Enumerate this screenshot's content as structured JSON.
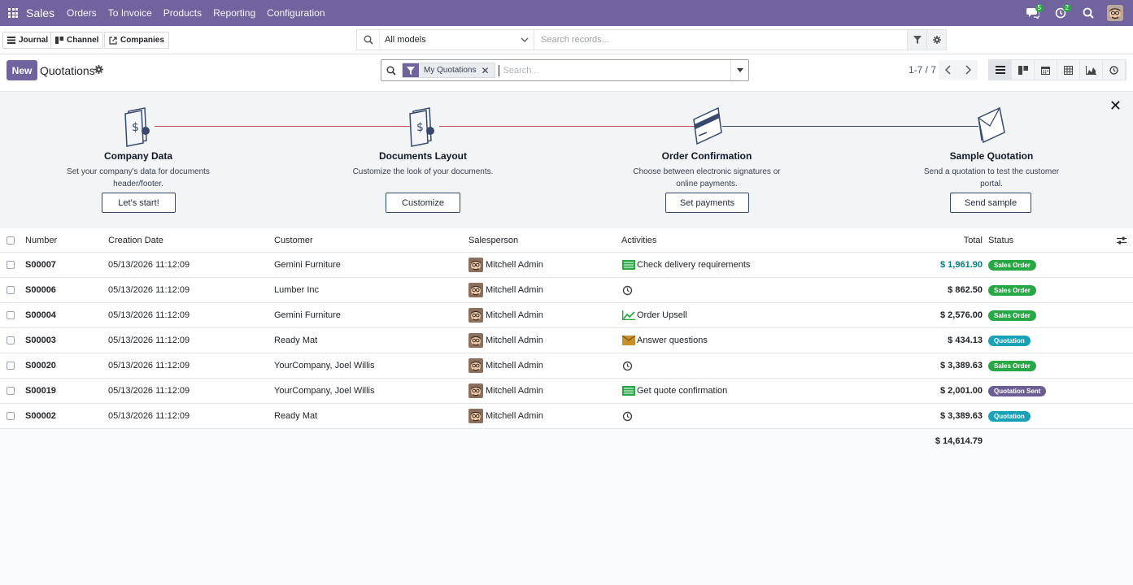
{
  "navbar": {
    "app_name": "Sales",
    "menu": [
      "Orders",
      "To Invoice",
      "Products",
      "Reporting",
      "Configuration"
    ],
    "messages_count": "5",
    "activities_count": "2"
  },
  "toolbar": {
    "journal": "Journal",
    "channel": "Channel",
    "companies": "Companies",
    "model_select": "All models",
    "search_placeholder": "Search records..."
  },
  "control": {
    "new_label": "New",
    "title": "Quotations",
    "facet": "My Quotations",
    "search_placeholder": "Search...",
    "pager": "1-7 / 7"
  },
  "onboarding": {
    "steps": [
      {
        "title": "Company Data",
        "desc1": "Set your company's data for documents",
        "desc2": "header/footer.",
        "button": "Let's start!"
      },
      {
        "title": "Documents Layout",
        "desc1": "Customize the look of your documents.",
        "desc2": "",
        "button": "Customize"
      },
      {
        "title": "Order Confirmation",
        "desc1": "Choose between electronic signatures or",
        "desc2": "online payments.",
        "button": "Set payments"
      },
      {
        "title": "Sample Quotation",
        "desc1": "Send a quotation to test the customer",
        "desc2": "portal.",
        "button": "Send sample"
      }
    ]
  },
  "table": {
    "headers": {
      "number": "Number",
      "date": "Creation Date",
      "customer": "Customer",
      "salesperson": "Salesperson",
      "activities": "Activities",
      "total": "Total",
      "status": "Status"
    },
    "rows": [
      {
        "number": "S00007",
        "date": "05/13/2026 11:12:09",
        "customer": "Gemini Furniture",
        "salesperson": "Mitchell Admin",
        "activity": "Check delivery requirements",
        "activity_icon": "todo-icon",
        "total": "$ 1,961.90",
        "status": "Sales Order"
      },
      {
        "number": "S00006",
        "date": "05/13/2026 11:12:09",
        "customer": "Lumber Inc",
        "salesperson": "Mitchell Admin",
        "activity": "",
        "activity_icon": "clock-icon",
        "total": "$ 862.50",
        "status": "Sales Order"
      },
      {
        "number": "S00004",
        "date": "05/13/2026 11:12:09",
        "customer": "Gemini Furniture",
        "salesperson": "Mitchell Admin",
        "activity": "Order Upsell",
        "activity_icon": "chart-icon",
        "total": "$ 2,576.00",
        "status": "Sales Order"
      },
      {
        "number": "S00003",
        "date": "05/13/2026 11:12:09",
        "customer": "Ready Mat",
        "salesperson": "Mitchell Admin",
        "activity": "Answer questions",
        "activity_icon": "envelope-icon",
        "total": "$ 434.13",
        "status": "Quotation"
      },
      {
        "number": "S00020",
        "date": "05/13/2026 11:12:09",
        "customer": "YourCompany, Joel Willis",
        "salesperson": "Mitchell Admin",
        "activity": "",
        "activity_icon": "clock-icon",
        "total": "$ 3,389.63",
        "status": "Sales Order"
      },
      {
        "number": "S00019",
        "date": "05/13/2026 11:12:09",
        "customer": "YourCompany, Joel Willis",
        "salesperson": "Mitchell Admin",
        "activity": "Get quote confirmation",
        "activity_icon": "todo-icon",
        "total": "$ 2,001.00",
        "status": "Quotation Sent"
      },
      {
        "number": "S00002",
        "date": "05/13/2026 11:12:09",
        "customer": "Ready Mat",
        "salesperson": "Mitchell Admin",
        "activity": "",
        "activity_icon": "clock-icon",
        "total": "$ 3,389.63",
        "status": "Quotation"
      }
    ],
    "grand_total": "$ 14,614.79"
  },
  "colors": {
    "brand": "#71639e",
    "sales_order": "#28a745",
    "quotation": "#17a2b8",
    "quotation_sent": "#6c5e94"
  }
}
